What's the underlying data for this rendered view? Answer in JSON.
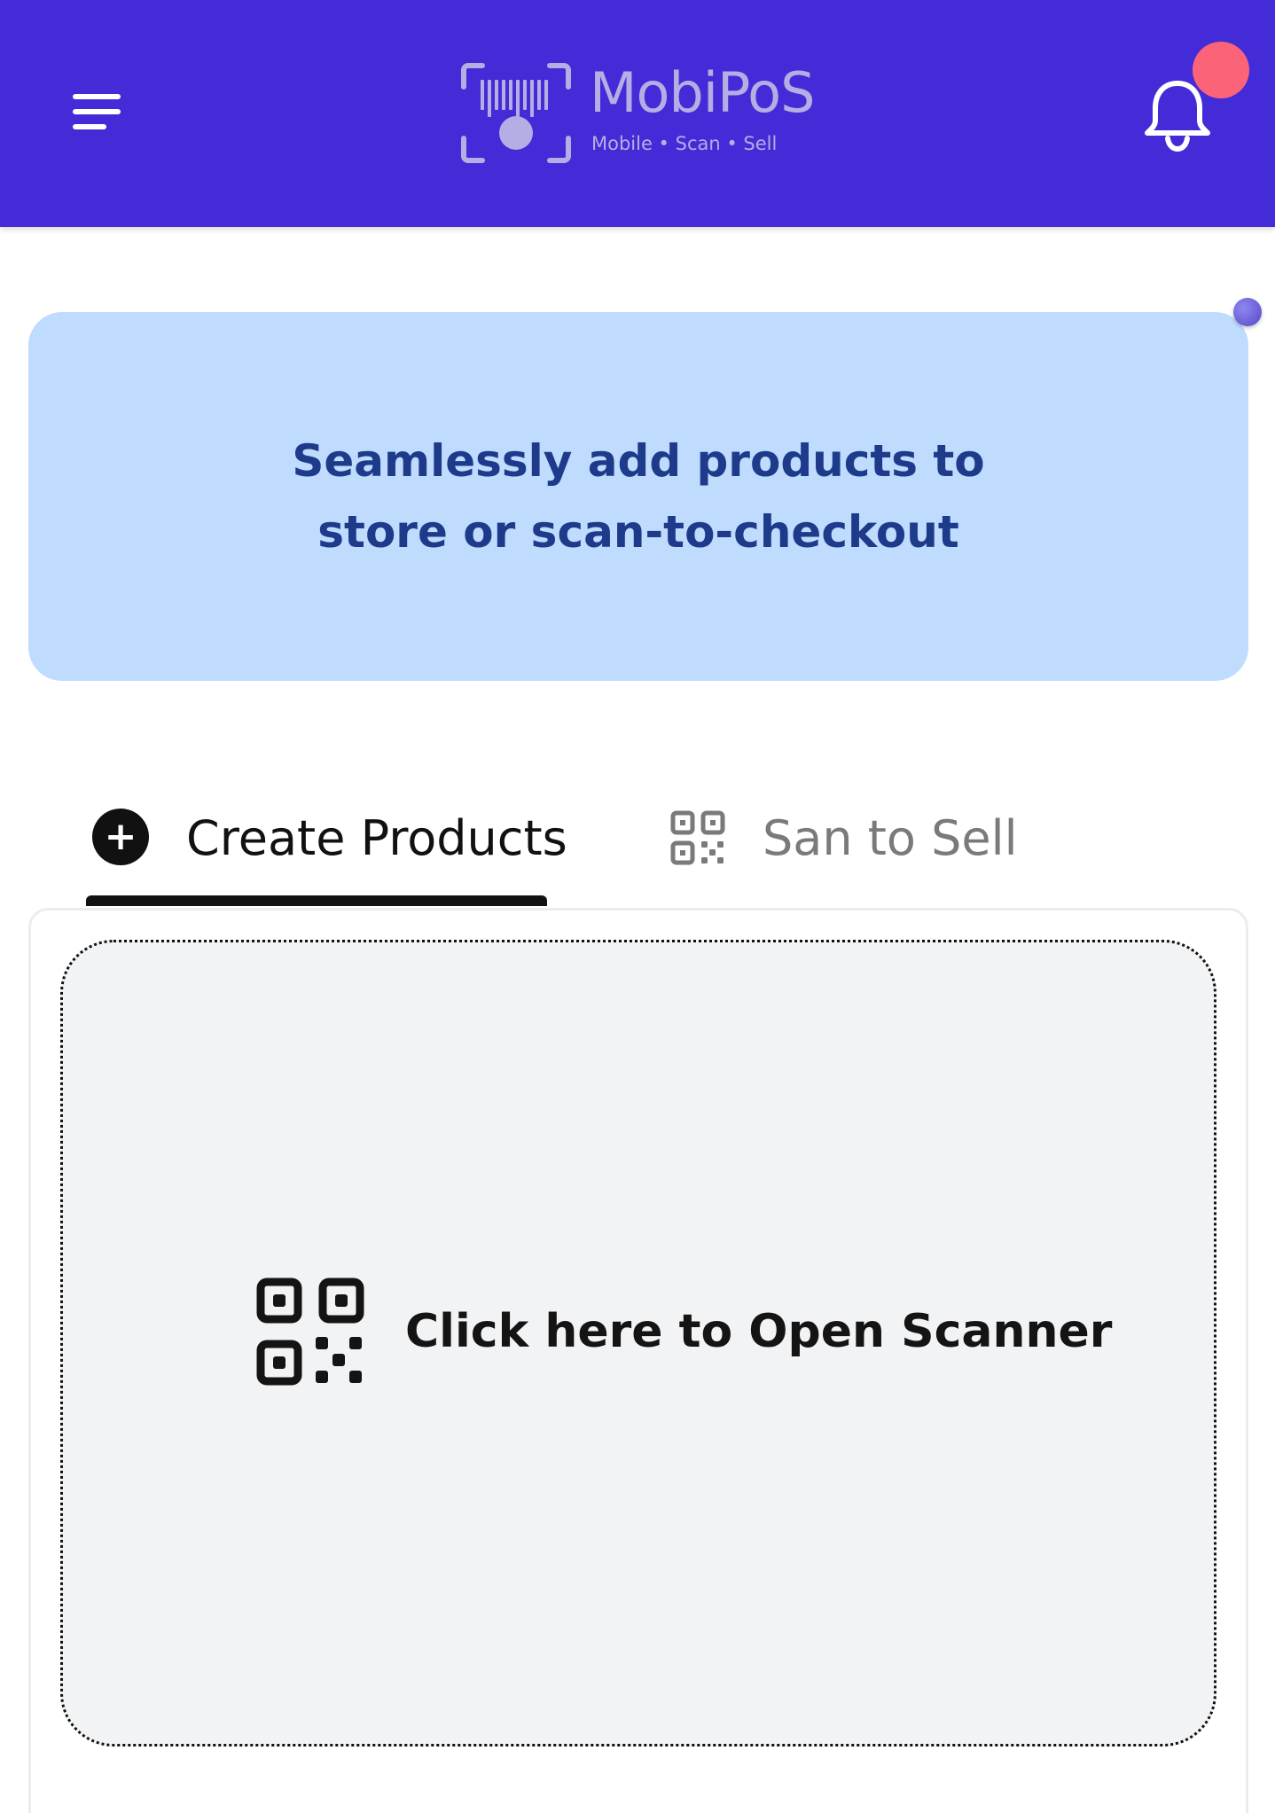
{
  "header": {
    "menu_icon": "hamburger-menu-icon",
    "logo": {
      "name": "MobiPoS",
      "tagline": "Mobile • Scan • Sell"
    },
    "notification_icon": "bell-icon",
    "colors": {
      "background": "#432bd7",
      "notification_dot": "#fb6478"
    }
  },
  "banner": {
    "text": "Seamlessly add products to store or scan-to-checkout",
    "colors": {
      "background": "#bfdbfe",
      "text": "#1e3a8a"
    }
  },
  "tabs": [
    {
      "label": "Create Products",
      "icon": "plus-circle-icon",
      "active": true
    },
    {
      "label": "San to Sell",
      "icon": "qr-code-icon",
      "active": false
    }
  ],
  "scanner": {
    "label": "Click here to Open Scanner",
    "icon": "qr-code-icon"
  }
}
